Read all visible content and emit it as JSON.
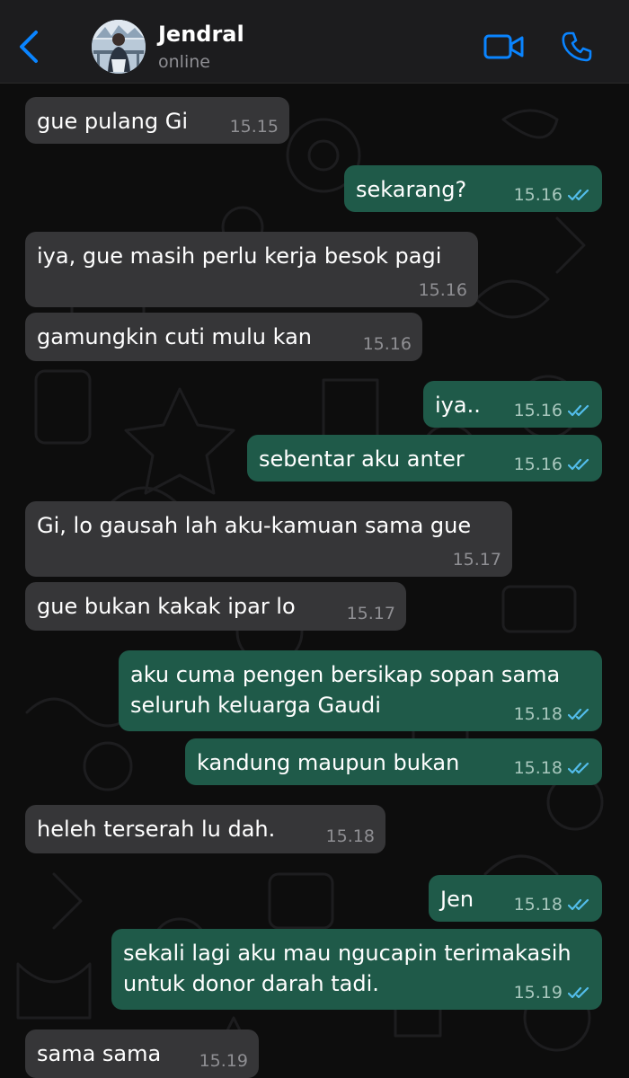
{
  "header": {
    "contact_name": "Jendral",
    "status": "online",
    "icons": {
      "back": "chevron-left-icon",
      "video": "video-camera-icon",
      "call": "phone-icon"
    }
  },
  "colors": {
    "accent": "#0a84ff",
    "incoming_bubble": "#363638",
    "outgoing_bubble": "#1f5a49",
    "read_ticks": "#53bdeb"
  },
  "messages": [
    {
      "dir": "in",
      "text": "gue pulang Gi",
      "time": "15.15"
    },
    {
      "dir": "out",
      "text": "sekarang?",
      "time": "15.16",
      "read": true
    },
    {
      "dir": "in",
      "text": "iya, gue masih perlu kerja besok pagi",
      "time": "15.16"
    },
    {
      "dir": "in",
      "text": "gamungkin cuti mulu kan",
      "time": "15.16"
    },
    {
      "dir": "out",
      "text": "iya..",
      "time": "15.16",
      "read": true
    },
    {
      "dir": "out",
      "text": "sebentar aku anter",
      "time": "15.16",
      "read": true
    },
    {
      "dir": "in",
      "text": "Gi, lo gausah lah aku-kamuan sama gue",
      "time": "15.17"
    },
    {
      "dir": "in",
      "text": "gue bukan kakak ipar lo",
      "time": "15.17"
    },
    {
      "dir": "out",
      "text": "aku cuma pengen bersikap sopan sama\nseluruh keluarga Gaudi",
      "time": "15.18",
      "read": true
    },
    {
      "dir": "out",
      "text": "kandung maupun bukan",
      "time": "15.18",
      "read": true
    },
    {
      "dir": "in",
      "text": "heleh terserah lu dah.",
      "time": "15.18"
    },
    {
      "dir": "out",
      "text": "Jen",
      "time": "15.18",
      "read": true
    },
    {
      "dir": "out",
      "text": "sekali lagi aku mau ngucapin terimakasih\nuntuk donor darah tadi.",
      "time": "15.19",
      "read": true
    },
    {
      "dir": "in",
      "text": "sama sama",
      "time": "15.19"
    }
  ]
}
